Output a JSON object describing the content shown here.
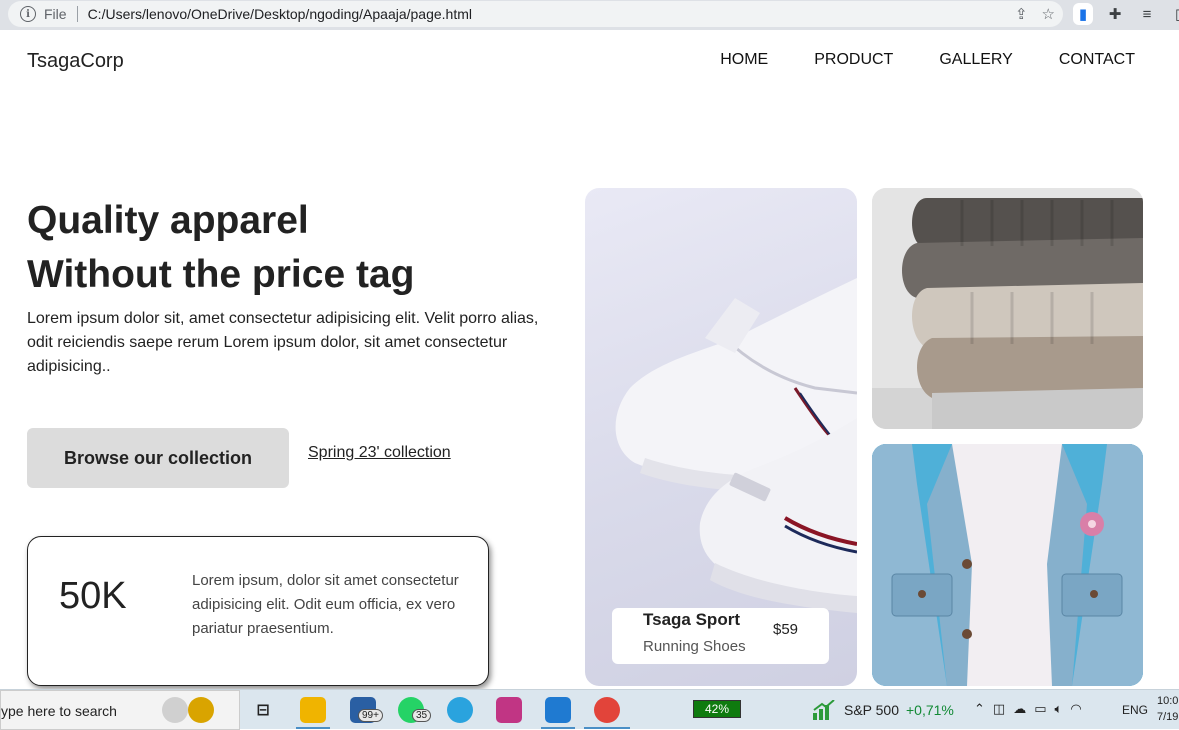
{
  "browser": {
    "file_label": "File",
    "url": "C:/Users/lenovo/OneDrive/Desktop/ngoding/Apaaja/page.html"
  },
  "site": {
    "logo": "TsagaCorp",
    "nav": [
      "HOME",
      "PRODUCT",
      "GALLERY",
      "CONTACT"
    ]
  },
  "hero": {
    "title_line1": "Quality apparel",
    "title_line2": "Without the price tag",
    "lead": "Lorem ipsum dolor sit, amet consectetur adipisicing elit. Velit porro alias, odit reiciendis saepe rerum Lorem ipsum dolor, sit amet consectetur adipisicing..",
    "browse_label": "Browse our collection",
    "spring_link": "Spring 23' collection"
  },
  "stat": {
    "value": "50K",
    "text": "Lorem ipsum, dolor sit amet consectetur adipisicing elit. Odit eum officia, ex vero pariatur praesentium."
  },
  "product": {
    "name": "Tsaga Sport",
    "category": "Running Shoes",
    "price": "$59"
  },
  "taskbar": {
    "search_placeholder": "ype here to search",
    "mail_badge": "99+",
    "whatsapp_badge": "35",
    "battery": "42%",
    "stock_name": "S&P 500",
    "stock_change": "+0,71%",
    "lang": "ENG",
    "time": "10:0",
    "date": "7/19"
  }
}
